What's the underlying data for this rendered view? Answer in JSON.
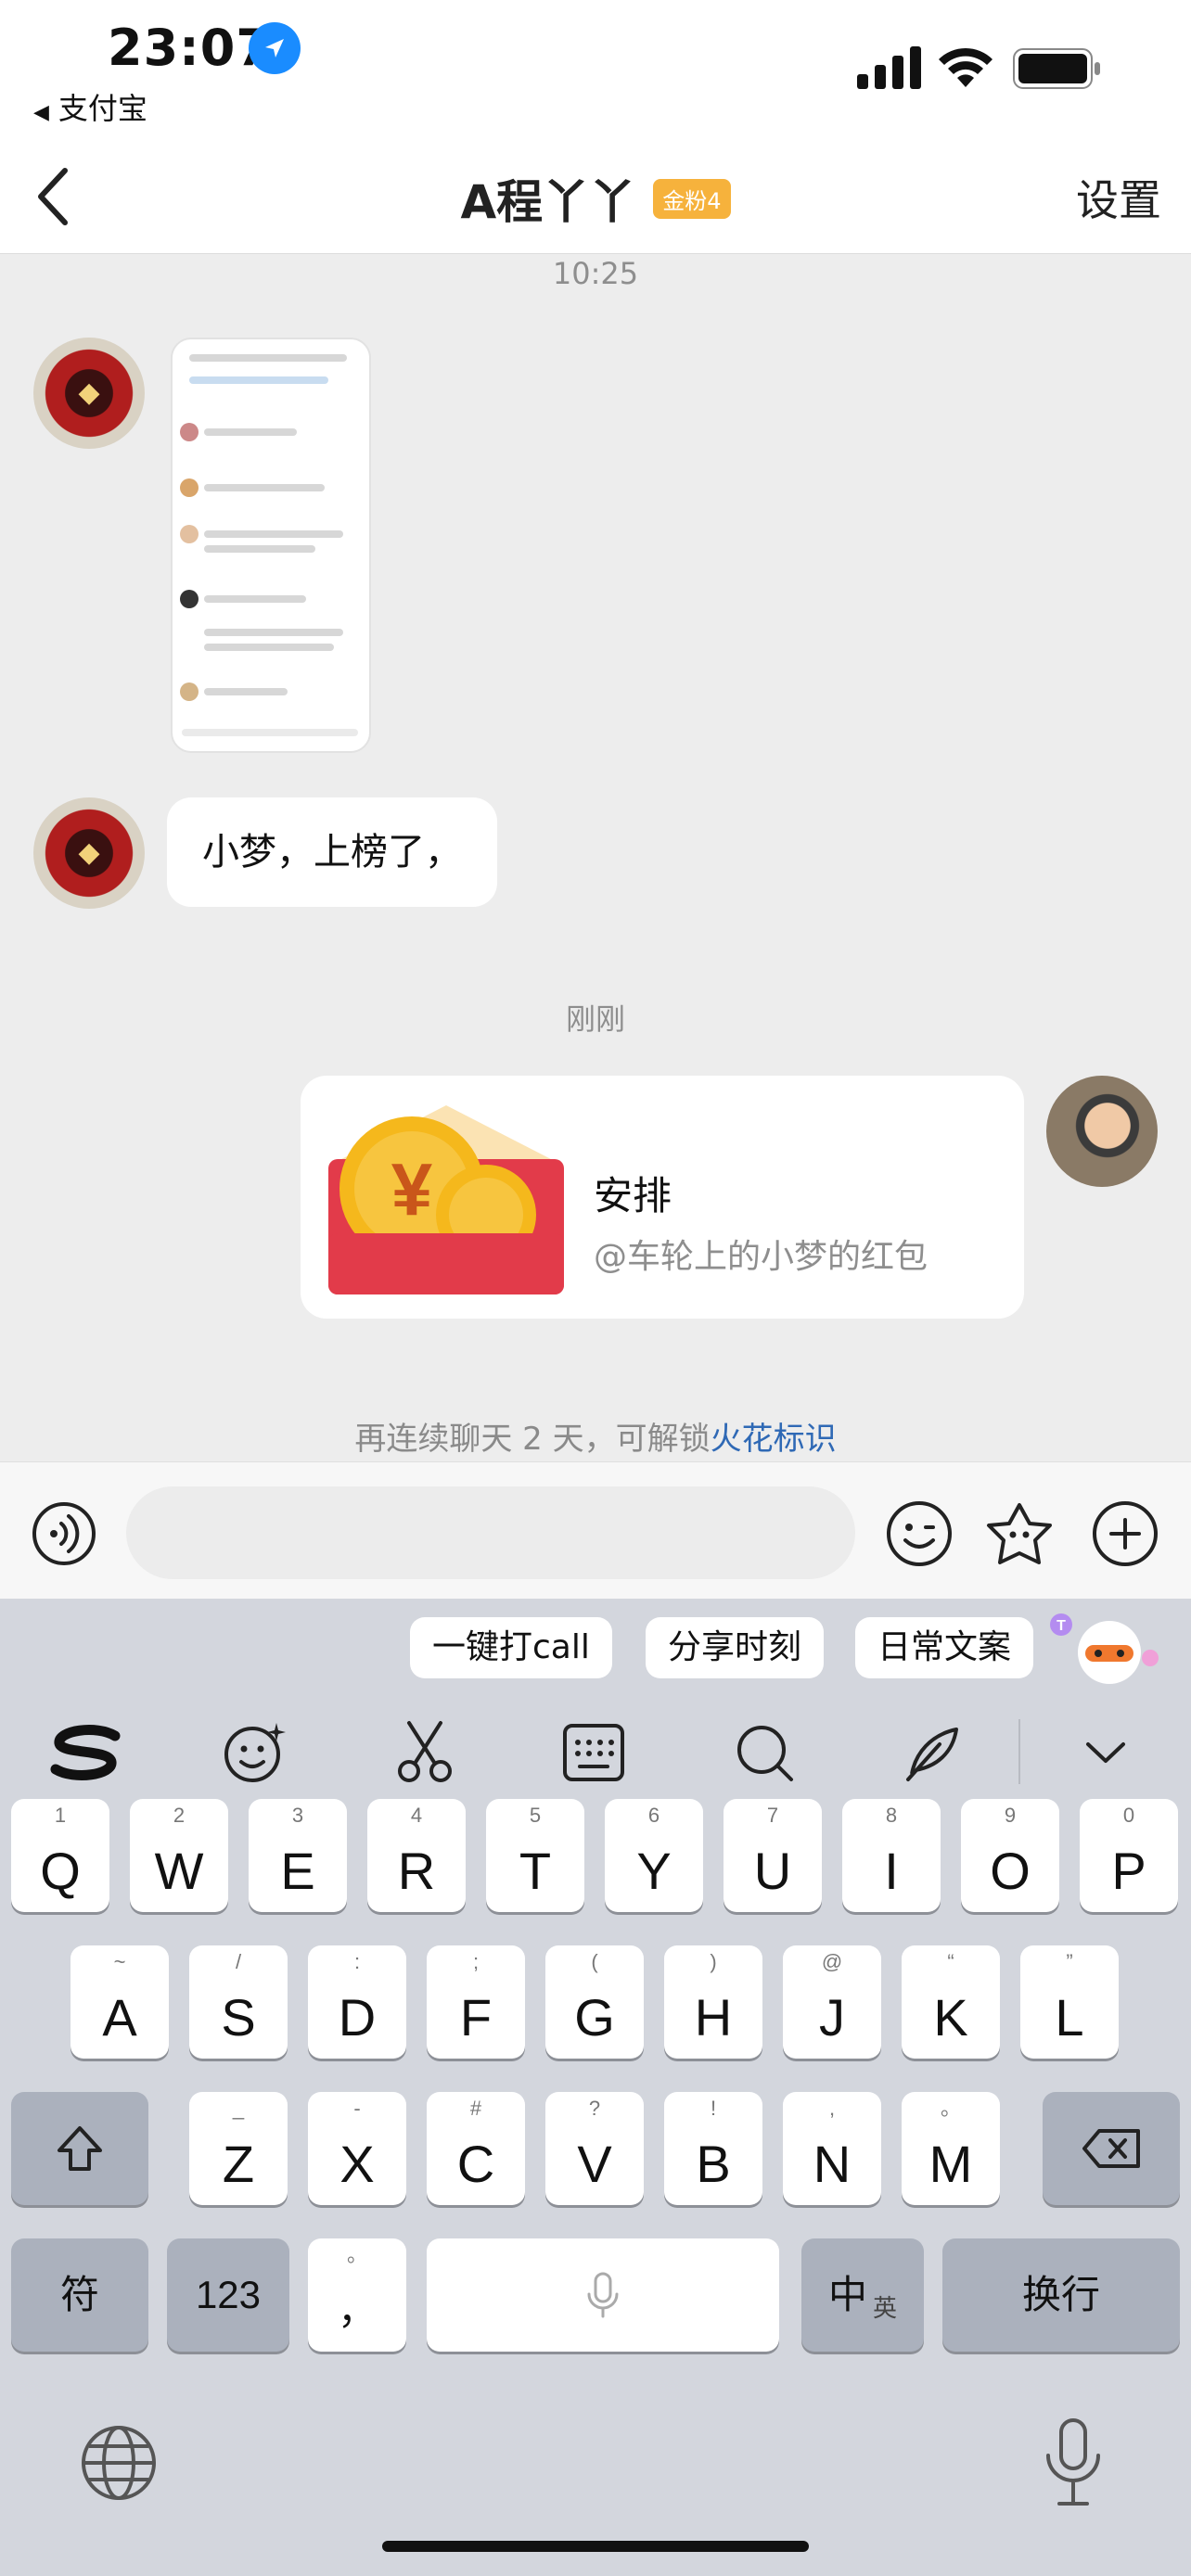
{
  "status_bar": {
    "time": "23:07",
    "back_app": "支付宝",
    "back_arrow": "◀"
  },
  "nav": {
    "title": "A程丫丫",
    "fan_badge": "金粉4",
    "settings": "设置"
  },
  "chat": {
    "timestamp_1": "10:25",
    "message_text": "小梦，上榜了，",
    "timestamp_2": "刚刚",
    "red_packet": {
      "title": "安排",
      "subtitle": "@车轮上的小梦的红包"
    },
    "spark_tip_prefix": "再连续聊天 2 天，可解锁",
    "spark_tip_link": "火花标识"
  },
  "input": {
    "placeholder": ""
  },
  "keyboard": {
    "suggestions": [
      "一键打call",
      "分享时刻",
      "日常文案"
    ],
    "row1": [
      {
        "k": "Q",
        "h": "1"
      },
      {
        "k": "W",
        "h": "2"
      },
      {
        "k": "E",
        "h": "3"
      },
      {
        "k": "R",
        "h": "4"
      },
      {
        "k": "T",
        "h": "5"
      },
      {
        "k": "Y",
        "h": "6"
      },
      {
        "k": "U",
        "h": "7"
      },
      {
        "k": "I",
        "h": "8"
      },
      {
        "k": "O",
        "h": "9"
      },
      {
        "k": "P",
        "h": "0"
      }
    ],
    "row2": [
      {
        "k": "A",
        "h": "~"
      },
      {
        "k": "S",
        "h": "/"
      },
      {
        "k": "D",
        "h": ":"
      },
      {
        "k": "F",
        "h": ";"
      },
      {
        "k": "G",
        "h": "("
      },
      {
        "k": "H",
        "h": ")"
      },
      {
        "k": "J",
        "h": "@"
      },
      {
        "k": "K",
        "h": "“"
      },
      {
        "k": "L",
        "h": "”"
      }
    ],
    "row3": [
      {
        "k": "Z",
        "h": "_"
      },
      {
        "k": "X",
        "h": "-"
      },
      {
        "k": "C",
        "h": "#"
      },
      {
        "k": "V",
        "h": "?"
      },
      {
        "k": "B",
        "h": "!"
      },
      {
        "k": "N",
        "h": ","
      },
      {
        "k": "M",
        "h": "。"
      }
    ],
    "symbols_key": "符",
    "numbers_key": "123",
    "punct_key": "，",
    "punct_hint": "。",
    "lang_key": "中",
    "lang_key_sub": "英",
    "return_key": "换行"
  },
  "colors": {
    "accent_link": "#2f69b5",
    "red_packet": "#e23b4a",
    "coin": "#f5b81c",
    "badge": "#f6b23c"
  }
}
